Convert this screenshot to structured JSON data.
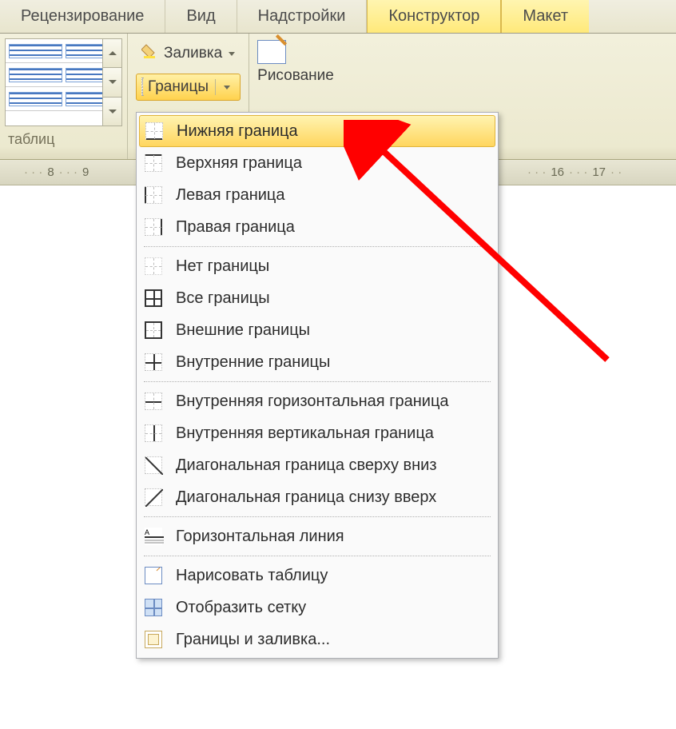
{
  "tabs": {
    "review": "Рецензирование",
    "view": "Вид",
    "addins": "Надстройки",
    "design": "Конструктор",
    "layout": "Макет"
  },
  "ribbon": {
    "fill_label": "Заливка",
    "borders_label": "Границы",
    "draw_label": "Рисование",
    "styles_label": "таблиц"
  },
  "ruler": {
    "seg1": "8",
    "seg2": "9",
    "seg3": "16",
    "seg4": "17"
  },
  "menu": {
    "items": [
      {
        "id": "bottom",
        "label": "Нижняя граница",
        "hl": true,
        "group": 0
      },
      {
        "id": "top",
        "label": "Верхняя граница",
        "group": 0
      },
      {
        "id": "left",
        "label": "Левая граница",
        "group": 0
      },
      {
        "id": "right",
        "label": "Правая граница",
        "group": 0
      },
      {
        "id": "none",
        "label": "Нет границы",
        "group": 1
      },
      {
        "id": "all",
        "label": "Все границы",
        "group": 1
      },
      {
        "id": "outside",
        "label": "Внешние границы",
        "group": 1
      },
      {
        "id": "inside",
        "label": "Внутренние границы",
        "group": 1
      },
      {
        "id": "ihoriz",
        "label": "Внутренняя горизонтальная граница",
        "group": 2
      },
      {
        "id": "ivert",
        "label": "Внутренняя вертикальная граница",
        "group": 2
      },
      {
        "id": "diagdn",
        "label": "Диагональная граница сверху вниз",
        "group": 2
      },
      {
        "id": "diagup",
        "label": "Диагональная граница снизу вверх",
        "group": 2
      },
      {
        "id": "hline",
        "label": "Горизонтальная линия",
        "group": 3
      },
      {
        "id": "draw",
        "label": "Нарисовать таблицу",
        "group": 4
      },
      {
        "id": "grid",
        "label": "Отобразить сетку",
        "group": 4
      },
      {
        "id": "dialog",
        "label": "Границы и заливка...",
        "group": 4
      }
    ]
  }
}
